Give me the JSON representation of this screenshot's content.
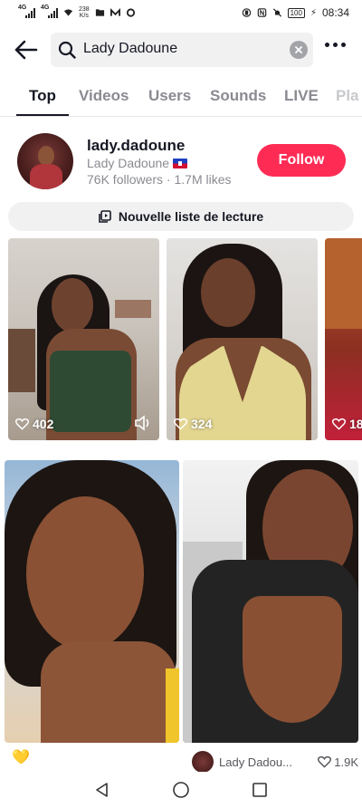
{
  "status_bar": {
    "signal1": "4G",
    "signal2": "4G",
    "netspeed_value": "238",
    "netspeed_unit": "K/s",
    "battery": "100",
    "time": "08:34"
  },
  "header": {
    "search_query": "Lady Dadoune",
    "icons": [
      "back-arrow-icon",
      "search-icon",
      "clear-icon",
      "more-icon"
    ]
  },
  "tabs": [
    {
      "label": "Top",
      "active": true
    },
    {
      "label": "Videos",
      "active": false
    },
    {
      "label": "Users",
      "active": false
    },
    {
      "label": "Sounds",
      "active": false
    },
    {
      "label": "LIVE",
      "active": false
    },
    {
      "label": "Pla",
      "active": false
    }
  ],
  "account": {
    "username": "lady.dadoune",
    "display_name": "Lady Dadoune",
    "stats": "76K followers · 1.7M likes",
    "follow_label": "Follow"
  },
  "playlist": {
    "label": "Nouvelle liste de lecture"
  },
  "carousel": [
    {
      "likes": "402",
      "has_sound_icon": true
    },
    {
      "likes": "324",
      "has_sound_icon": false
    },
    {
      "likes": "18",
      "has_sound_icon": false
    }
  ],
  "grid": [
    {
      "caption": "💛"
    },
    {
      "author": "Lady Dadou...",
      "likes": "1.9K"
    }
  ],
  "colors": {
    "accent": "#fe2c55",
    "text_primary": "#161823",
    "text_secondary": "#8a8b91",
    "surface": "#f1f1f2"
  }
}
